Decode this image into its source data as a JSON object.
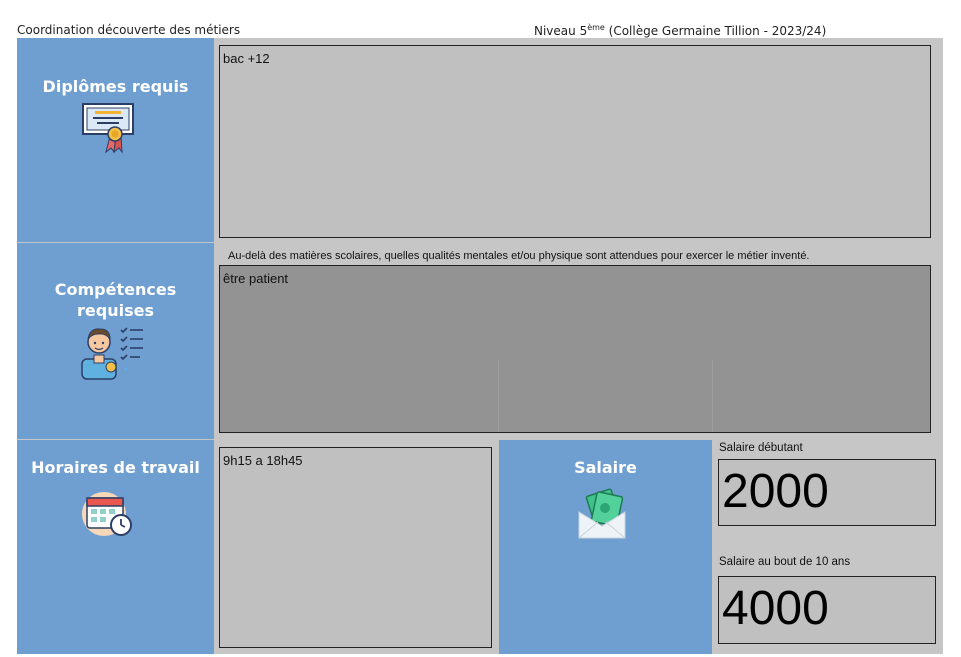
{
  "header": {
    "left": "Coordination découverte des métiers",
    "right_prefix": "Niveau 5",
    "right_sup": "ème",
    "right_suffix": " (Collège Germaine Tillion - 2023/24)"
  },
  "diplomes": {
    "title": "Diplômes requis",
    "icon": "diploma-icon",
    "answer": "bac +12"
  },
  "competences": {
    "title_line1": "Compétences",
    "title_line2": "requises",
    "icon": "skills-checklist-icon",
    "instruction": "Au-delà des matières scolaires, quelles qualités mentales et/ou physique sont attendues pour exercer le métier inventé.",
    "answer": "être patient"
  },
  "horaires": {
    "title": "Horaires de travail",
    "icon": "calendar-clock-icon",
    "answer": "9h15  a 18h45"
  },
  "salaire": {
    "title": "Salaire",
    "icon": "money-envelope-icon",
    "debutant_label": "Salaire débutant",
    "debutant_value": "2000",
    "dix_ans_label": "Salaire au bout de 10 ans",
    "dix_ans_value": "4000"
  },
  "colors": {
    "blue_panel": "#6f9fd0",
    "grey_frame": "#c6c6c6",
    "answer_box": "#c0c0c0",
    "dark_box": "#939393"
  }
}
